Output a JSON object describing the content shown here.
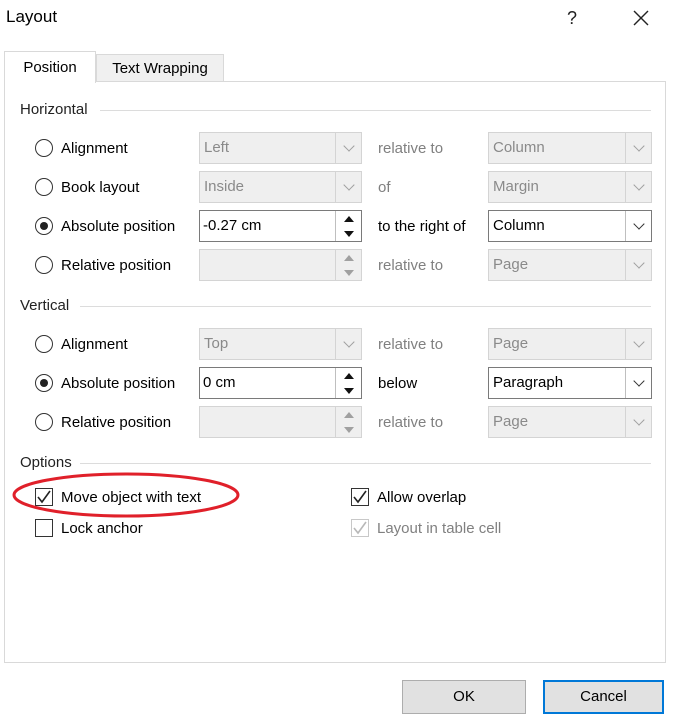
{
  "dialog": {
    "title": "Layout",
    "help_label": "?",
    "close_label": "✕"
  },
  "tabs": [
    {
      "label": "Position",
      "active": true
    },
    {
      "label": "Text Wrapping",
      "active": false
    }
  ],
  "horizontal": {
    "title": "Horizontal",
    "rows": [
      {
        "label": "Alignment",
        "selected": false,
        "value": "Left",
        "relation": "relative to",
        "relative": "Column",
        "enabled": false
      },
      {
        "label": "Book layout",
        "selected": false,
        "value": "Inside",
        "relation": "of",
        "relative": "Margin",
        "enabled": false
      },
      {
        "label": "Absolute position",
        "selected": true,
        "value": "-0.27 cm",
        "relation": "to the right of",
        "relative": "Column",
        "enabled": true
      },
      {
        "label": "Relative position",
        "selected": false,
        "value": "",
        "relation": "relative to",
        "relative": "Page",
        "enabled": false
      }
    ]
  },
  "vertical": {
    "title": "Vertical",
    "rows": [
      {
        "label": "Alignment",
        "selected": false,
        "value": "Top",
        "relation": "relative to",
        "relative": "Page",
        "enabled": false
      },
      {
        "label": "Absolute position",
        "selected": true,
        "value": "0 cm",
        "relation": "below",
        "relative": "Paragraph",
        "enabled": true
      },
      {
        "label": "Relative position",
        "selected": false,
        "value": "",
        "relation": "relative to",
        "relative": "Page",
        "enabled": false
      }
    ]
  },
  "options": {
    "title": "Options",
    "move_object_with_text": {
      "label": "Move object with text",
      "checked": true
    },
    "lock_anchor": {
      "label": "Lock anchor",
      "checked": false
    },
    "allow_overlap": {
      "label": "Allow overlap",
      "checked": true
    },
    "layout_in_table_cell": {
      "label": "Layout in table cell",
      "checked": true,
      "enabled": false
    }
  },
  "buttons": {
    "ok": "OK",
    "cancel": "Cancel"
  },
  "annotation": {
    "color": "#e0202a",
    "shape": "ellipse"
  },
  "colors": {
    "focus": "#0078d7",
    "annotation": "#e0202a"
  }
}
